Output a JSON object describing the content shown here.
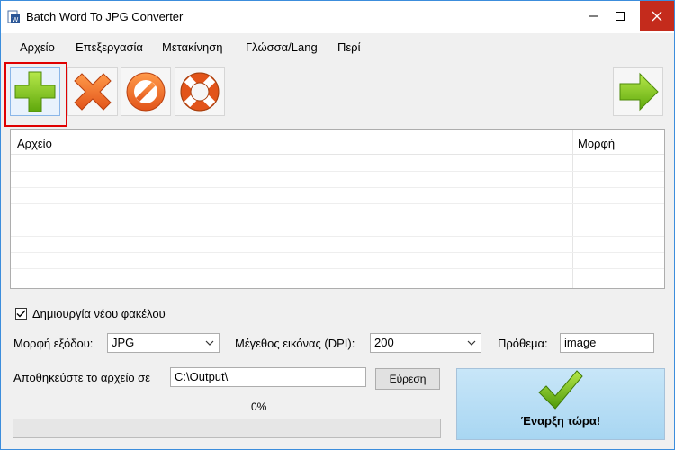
{
  "window": {
    "title": "Batch Word To JPG Converter"
  },
  "menu": {
    "items": [
      "Αρχείο",
      "Επεξεργασία",
      "Μετακίνηση",
      "Γλώσσα/Lang",
      "Περί"
    ]
  },
  "toolbar": {
    "buttons": [
      "add-icon",
      "delete-icon",
      "stop-icon",
      "lifebuoy-icon",
      "arrow-right-icon"
    ]
  },
  "file_list": {
    "columns": [
      "Αρχείο",
      "Μορφή"
    ],
    "rows": []
  },
  "options": {
    "create_folder_label": "Δημιουργία νέου φακέλου",
    "create_folder_checked": true,
    "output_format_label": "Μορφή εξόδου:",
    "output_format_value": "JPG",
    "dpi_label": "Μέγεθος εικόνας (DPI):",
    "dpi_value": "200",
    "prefix_label": "Πρόθεμα:",
    "prefix_value": "image",
    "save_to_label": "Αποθηκεύστε το αρχείο σε",
    "save_to_value": "C:\\Output\\",
    "browse_label": "Εύρεση"
  },
  "progress": {
    "text": "0%",
    "value": 0
  },
  "start": {
    "label": "Έναρξη τώρα!"
  },
  "colors": {
    "close_button": "#c42b1c",
    "add_highlight": "#e00000",
    "progress": "#06b025"
  }
}
